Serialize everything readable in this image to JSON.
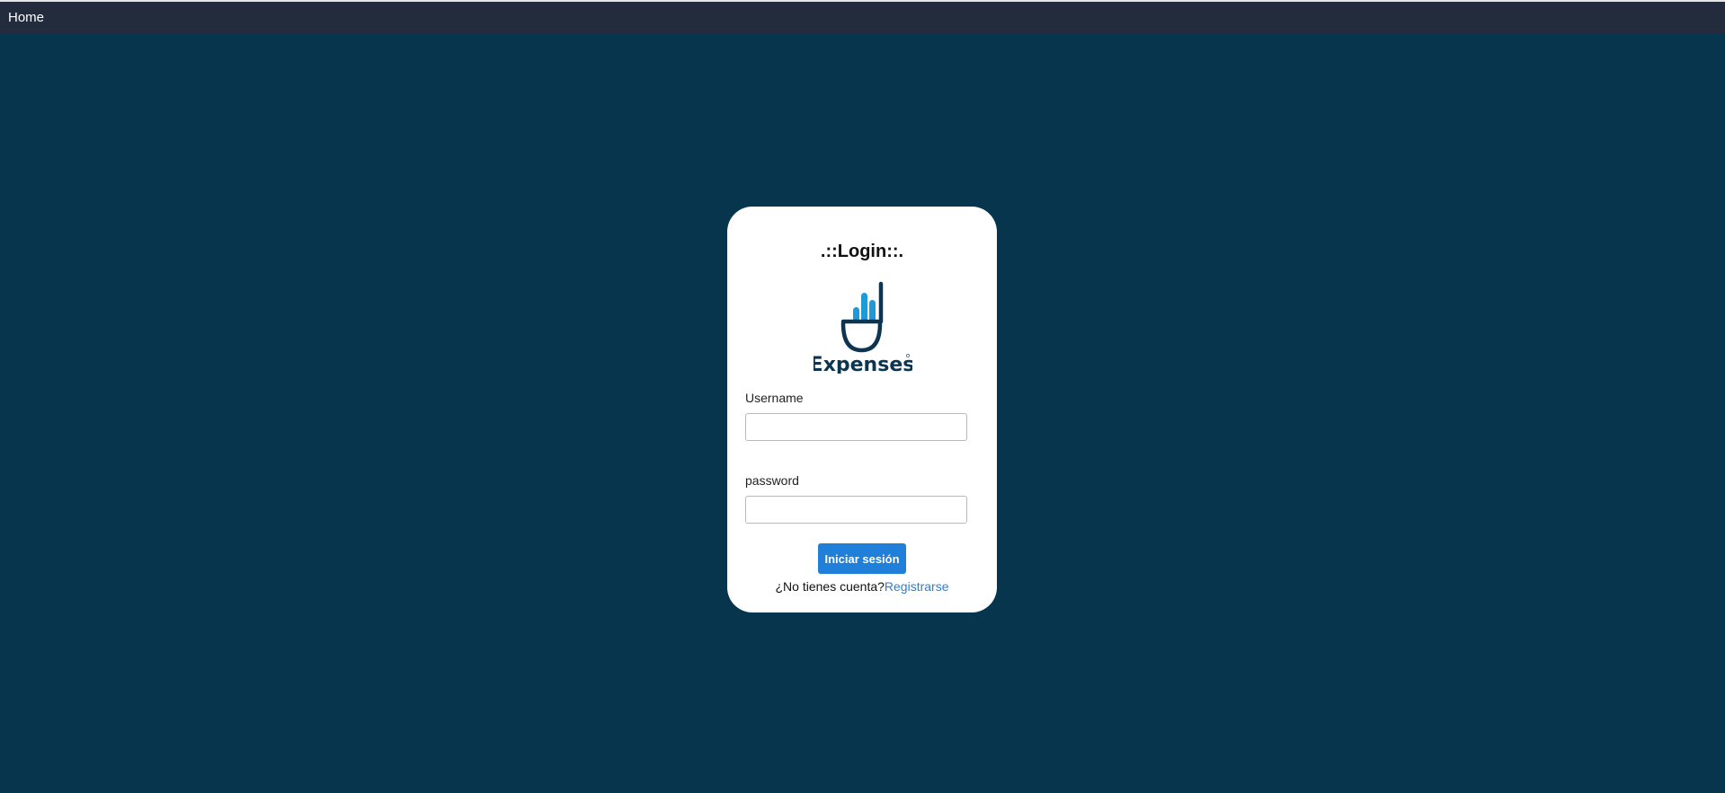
{
  "nav": {
    "home_label": "Home"
  },
  "login": {
    "title": ".::Login::.",
    "logo_text": "Expenses",
    "username_label": "Username",
    "username_value": "",
    "password_label": "password",
    "password_value": "",
    "submit_label": "Iniciar sesión",
    "no_account_text": "¿No tienes cuenta?",
    "register_link": "Registrarse"
  },
  "colors": {
    "page_background": "#06354d",
    "topbar_background": "#222c3d",
    "button": "#1f7fd9",
    "link": "#2a7fd4",
    "logo_dark": "#0b3550",
    "logo_light": "#1e9ad6"
  },
  "icons": {
    "logo": "expenses-logo-hand-chart"
  }
}
